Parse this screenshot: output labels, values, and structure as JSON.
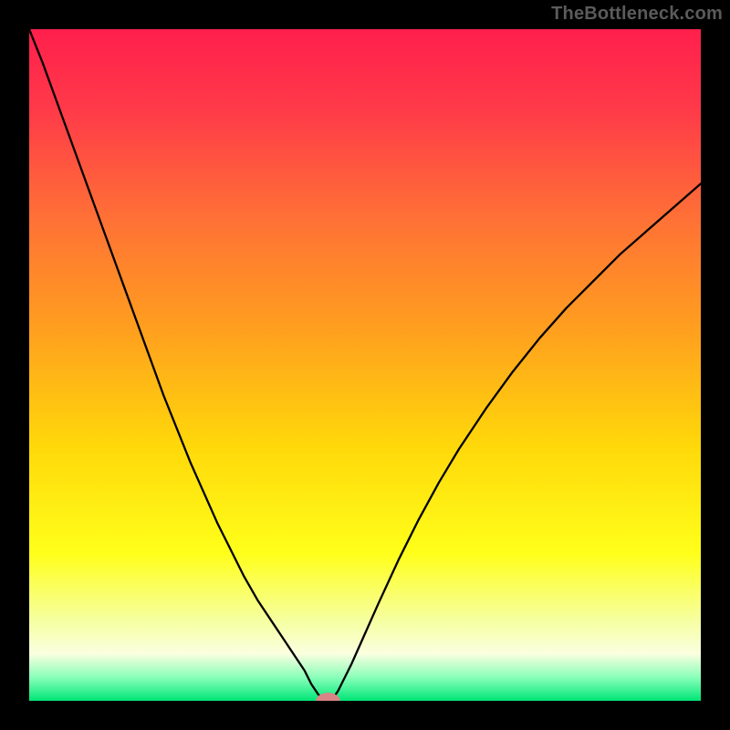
{
  "watermark": "TheBottleneck.com",
  "chart_data": {
    "type": "line",
    "title": "",
    "xlabel": "",
    "ylabel": "",
    "xlim": [
      0,
      100
    ],
    "ylim": [
      0,
      100
    ],
    "grid": false,
    "background": {
      "type": "vertical-gradient",
      "stops": [
        {
          "offset": 0.0,
          "color": "#ff1f4c"
        },
        {
          "offset": 0.12,
          "color": "#ff3a49"
        },
        {
          "offset": 0.28,
          "color": "#ff7036"
        },
        {
          "offset": 0.45,
          "color": "#ffa01e"
        },
        {
          "offset": 0.62,
          "color": "#ffd80a"
        },
        {
          "offset": 0.78,
          "color": "#ffff1a"
        },
        {
          "offset": 0.88,
          "color": "#f6ffa0"
        },
        {
          "offset": 0.93,
          "color": "#faffe0"
        },
        {
          "offset": 0.965,
          "color": "#8affba"
        },
        {
          "offset": 1.0,
          "color": "#00e676"
        }
      ]
    },
    "series": [
      {
        "name": "bottleneck-curve",
        "color": "#000000",
        "stroke_width": 2.3,
        "x": [
          0.0,
          2.0,
          4.0,
          6.0,
          8.0,
          10.0,
          12.0,
          14.0,
          16.0,
          18.0,
          20.0,
          22.0,
          24.0,
          26.0,
          28.0,
          30.0,
          32.0,
          34.0,
          36.0,
          38.0,
          40.0,
          41.0,
          42.0,
          43.0,
          44.0,
          45.0,
          46.0,
          48.0,
          50.0,
          52.0,
          55.0,
          58.0,
          61.0,
          64.0,
          68.0,
          72.0,
          76.0,
          80.0,
          84.0,
          88.0,
          92.0,
          96.0,
          100.0
        ],
        "y": [
          100.0,
          95.0,
          89.5,
          84.0,
          78.5,
          73.0,
          67.5,
          62.0,
          56.5,
          51.0,
          45.5,
          40.5,
          35.5,
          31.0,
          26.5,
          22.5,
          18.5,
          15.0,
          12.0,
          9.0,
          6.0,
          4.5,
          2.5,
          1.0,
          0.0,
          0.0,
          1.5,
          5.5,
          10.0,
          14.5,
          21.0,
          27.0,
          32.5,
          37.5,
          43.5,
          49.0,
          54.0,
          58.5,
          62.5,
          66.5,
          70.0,
          73.5,
          77.0
        ]
      }
    ],
    "marker": {
      "name": "optimum-marker",
      "x": 44.5,
      "y": 0.0,
      "color": "#d98588",
      "rx": 1.8,
      "ry": 1.2
    }
  }
}
